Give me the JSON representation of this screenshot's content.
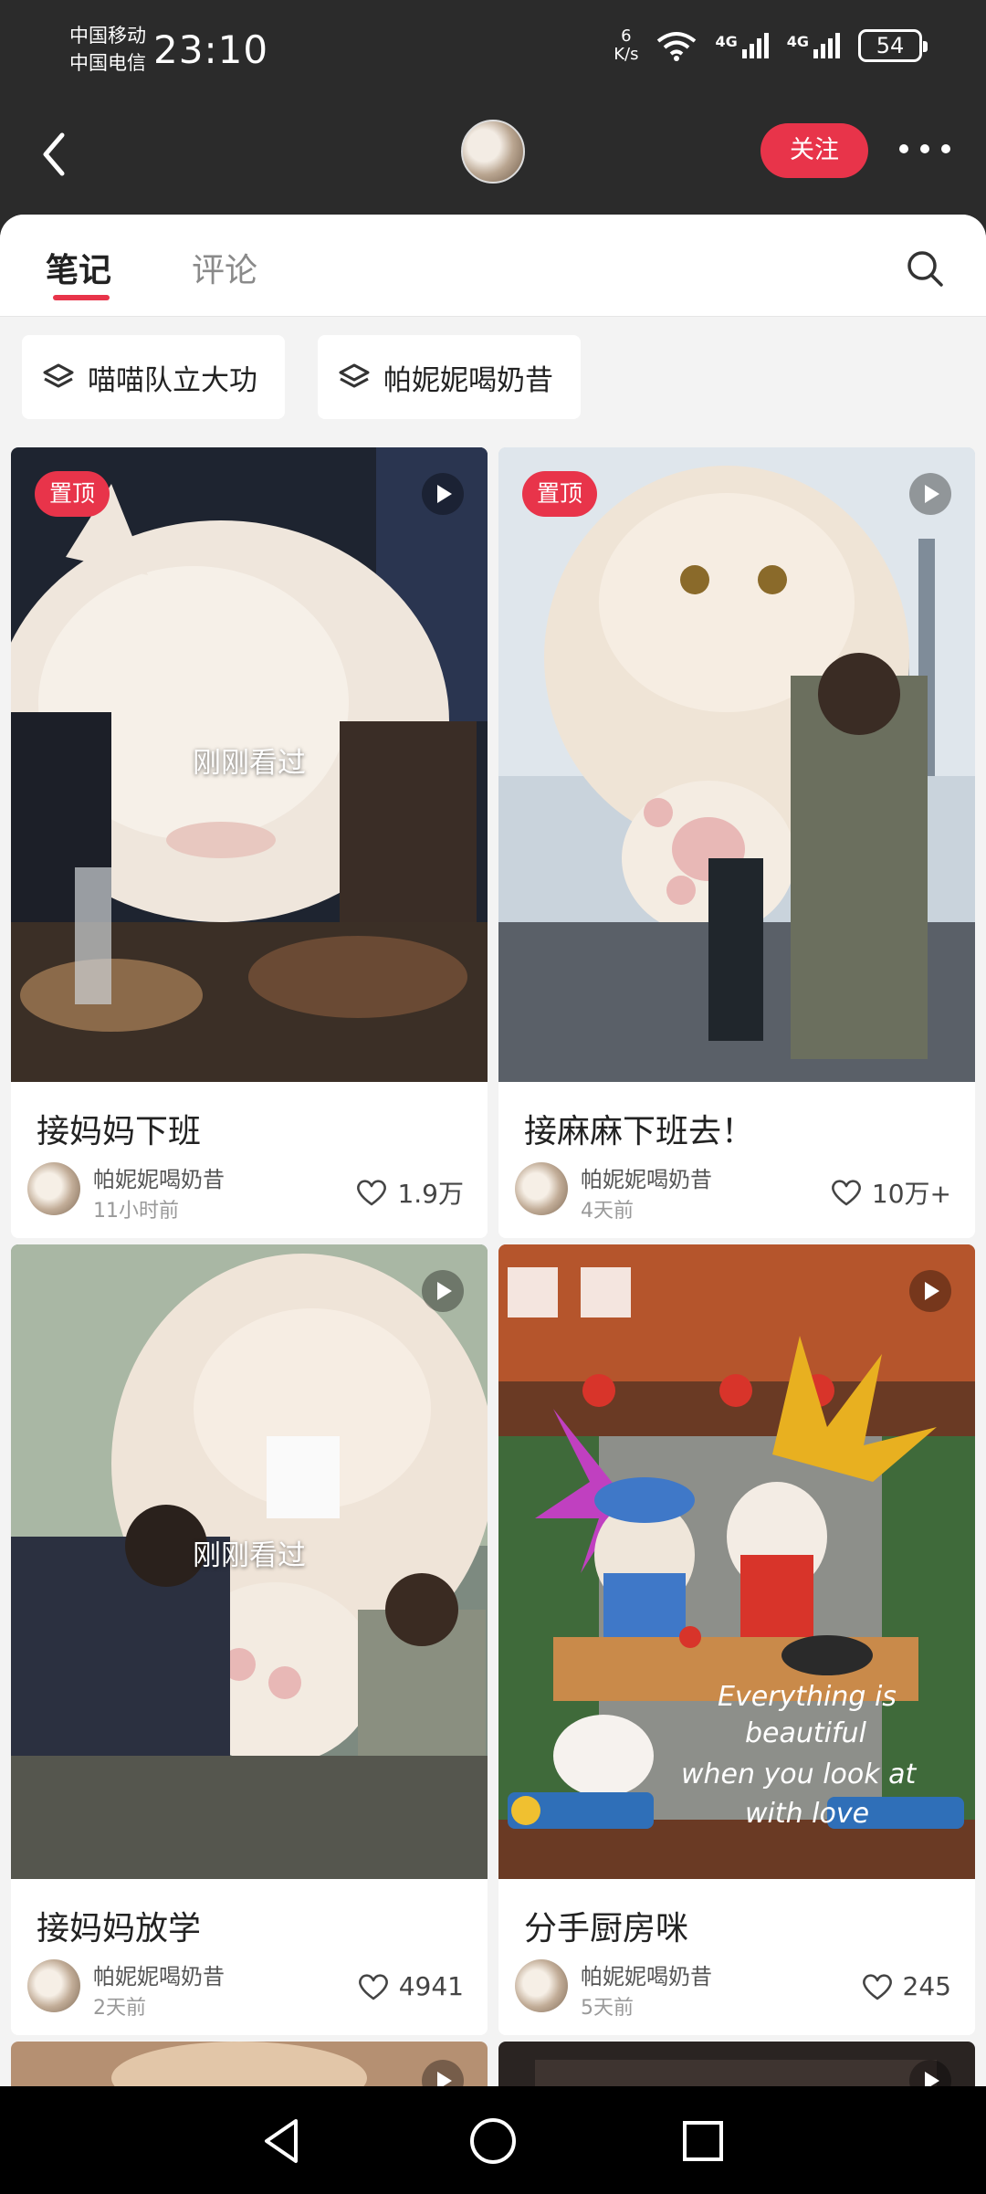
{
  "status_bar": {
    "carrier1": "中国移动",
    "carrier2": "中国电信",
    "time": "23:10",
    "net_speed_value": "6",
    "net_speed_unit": "K/s",
    "signal1": "4G",
    "signal2": "4G",
    "battery": "54"
  },
  "header": {
    "follow_label": "关注"
  },
  "tabs": [
    {
      "label": "笔记"
    },
    {
      "label": "评论"
    }
  ],
  "collections": [
    {
      "label": "喵喵队立大功"
    },
    {
      "label": "帕妮妮喝奶昔"
    }
  ],
  "notes": [
    {
      "title": "接妈妈下班",
      "author": "帕妮妮喝奶昔",
      "time": "11小时前",
      "likes": "1.9万",
      "badge": "置顶",
      "overlay": "刚刚看过"
    },
    {
      "title": "接麻麻下班去！",
      "author": "帕妮妮喝奶昔",
      "time": "4天前",
      "likes": "10万+",
      "badge": "置顶"
    },
    {
      "title": "接妈妈放学",
      "author": "帕妮妮喝奶昔",
      "time": "2天前",
      "likes": "4941",
      "overlay": "刚刚看过"
    },
    {
      "title": "分手厨房咪",
      "author": "帕妮妮喝奶昔",
      "time": "5天前",
      "likes": "245"
    }
  ],
  "colors": {
    "accent": "#e8344a",
    "header_bg": "#2b2b2b",
    "feed_bg": "#f3f3f3"
  }
}
